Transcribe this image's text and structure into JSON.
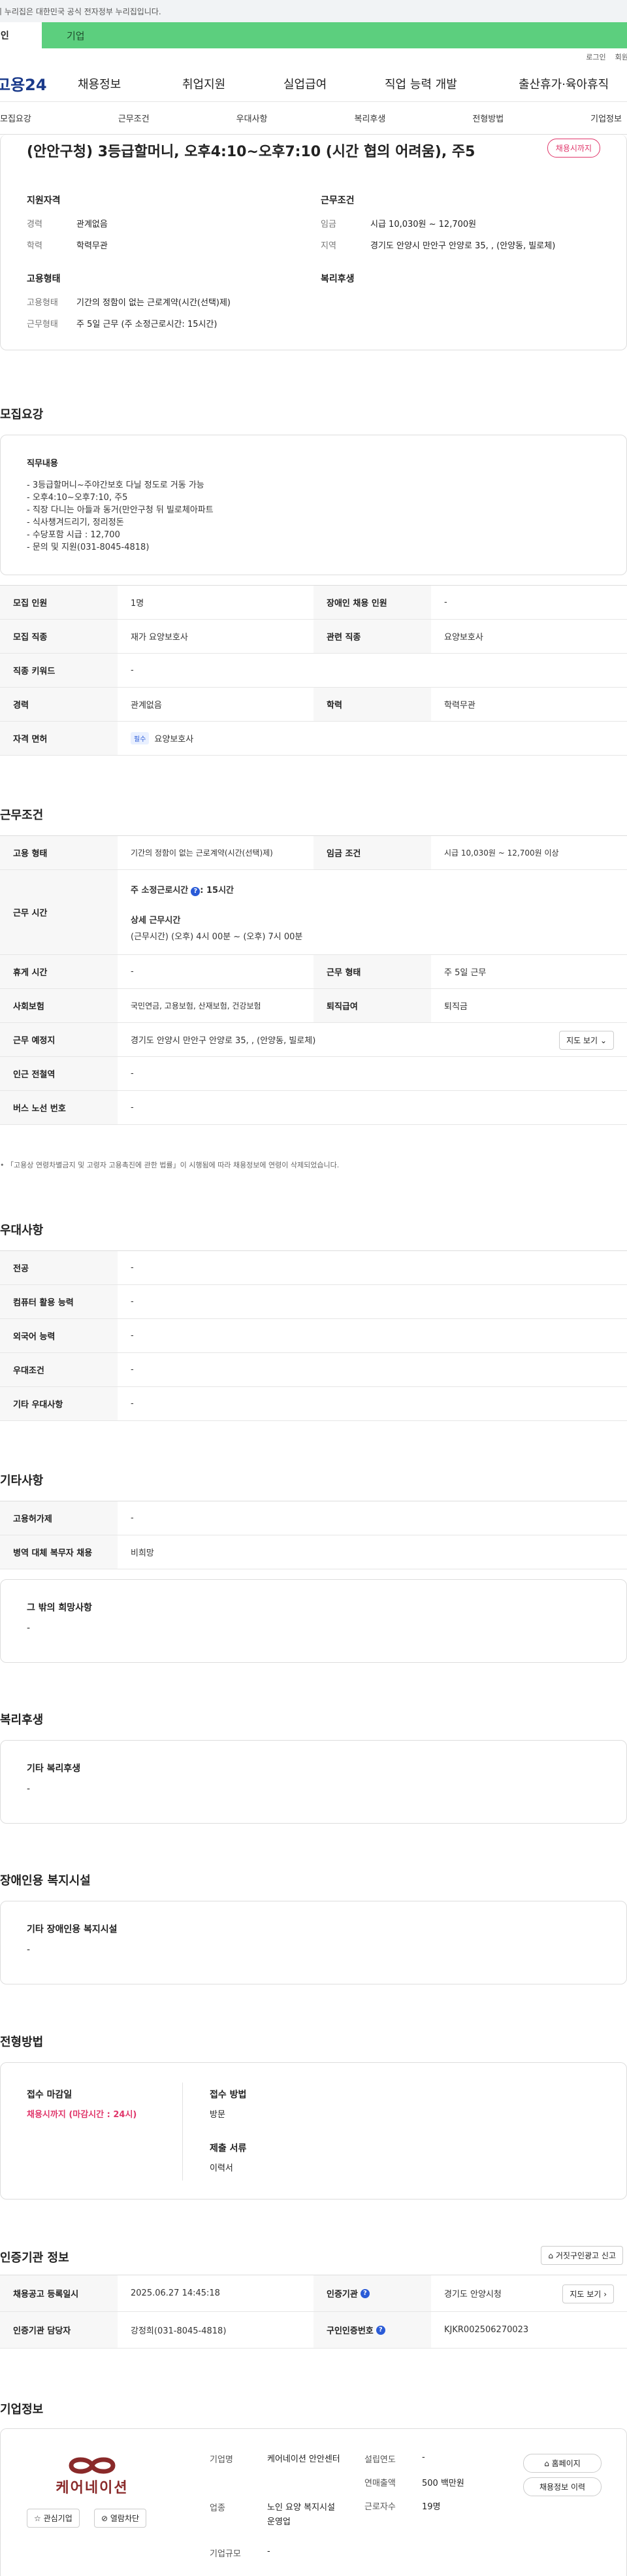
{
  "gov_notice": "이 누리집은 대한민국 공식 전자정부 누리집입니다.",
  "top_tabs": {
    "personal": "개인",
    "company": "기업"
  },
  "util": {
    "login": "로그인",
    "signup": "회원가"
  },
  "gnb": {
    "logo": "고용24",
    "items": [
      "채용정보",
      "취업지원",
      "실업급여",
      "직업 능력 개발",
      "출산휴가·육아휴직"
    ]
  },
  "subnav": [
    "모집요강",
    "근무조건",
    "우대사항",
    "복리후생",
    "전형방법",
    "기업정보"
  ],
  "summary": {
    "title": "(안안구청) 3등급할머니, 오후4:10~오후7:10 (시간 협의 어려움), 주5",
    "badge": "채용시까지",
    "qual": {
      "heading": "지원자격",
      "rows": [
        [
          "경력",
          "관계없음"
        ],
        [
          "학력",
          "학력무관"
        ]
      ]
    },
    "cond": {
      "heading": "근무조건",
      "rows": [
        [
          "임금",
          "시급 10,030원 ~ 12,700원"
        ],
        [
          "지역",
          "경기도 안양시 만안구 안양로 35, , (안양동, 빌로체)"
        ]
      ]
    },
    "emp": {
      "heading": "고용형태",
      "rows": [
        [
          "고용형태",
          "기간의 정함이 없는 근로계약(시간(선택)제)"
        ],
        [
          "근무형태",
          "주 5일 근무 (주 소정근로시간: 15시간)"
        ]
      ]
    },
    "welfare": {
      "heading": "복리후생"
    }
  },
  "recruit": {
    "title": "모집요강",
    "duty_heading": "직무내용",
    "duty_lines": [
      "- 3등급할머니~주야간보호 다닐 정도로 거동 가능",
      "- 오후4:10~오후7:10, 주5",
      "- 직장 다니는 아들과 동거(만안구청 뒤 빌로체아파트",
      "- 식사챙겨드리기, 정리정돈",
      "- 수당포함 시급 : 12,700",
      "- 문의 및 지원(031-8045-4818)"
    ],
    "rows": [
      {
        "k1": "모집 인원",
        "v1": "1명",
        "k2": "장애인 채용 인원",
        "v2": "-"
      },
      {
        "k1": "모집 직종",
        "v1": "재가 요양보호사",
        "k2": "관련 직종",
        "v2": "요양보호사"
      },
      {
        "k1": "직종 키워드",
        "v1": "-"
      },
      {
        "k1": "경력",
        "v1": "관계없음",
        "k2": "학력",
        "v2": "학력무관"
      },
      {
        "k1": "자격 면허",
        "tag": "필수",
        "v1": "요양보호사"
      }
    ]
  },
  "work": {
    "title": "근무조건",
    "emp_k": "고용 형태",
    "emp_v": "기간의 정함이 없는 근로계약(시간(선택)제)",
    "wage_k": "임금 조건",
    "wage_v": "시급 10,030원 ~ 12,700원 이상",
    "time_k": "근무 시간",
    "time_weekly": "주 소정근로시간",
    "time_weekly_v": ": 15시간",
    "time_detail_h": "상세 근무시간",
    "time_detail": "(근무시간) (오후) 4시 00분 ~ (오후) 7시 00분",
    "rest_k": "휴게 시간",
    "rest_v": "-",
    "form_k": "근무 형태",
    "form_v": "주 5일 근무",
    "ins_k": "사회보험",
    "ins_v": "국민연금, 고용보험, 산재보험, 건강보험",
    "ret_k": "퇴직급여",
    "ret_v": "퇴직금",
    "place_k": "근무 예정지",
    "place_v": "경기도 안양시 만안구 안양로 35, , (안양동, 빌로체)",
    "map_btn": "지도 보기",
    "sub_k": "인근 전철역",
    "sub_v": "-",
    "bus_k": "버스 노선 번호",
    "bus_v": "-",
    "note": "「고용상 연령차별금지 및 고령자 고용촉진에 관한 법률」이 시행됨에 따라 채용정보에 연령이 삭제되었습니다."
  },
  "pref": {
    "title": "우대사항",
    "rows": [
      [
        "전공",
        "-"
      ],
      [
        "컴퓨터 활용 능력",
        "-"
      ],
      [
        "외국어 능력",
        "-"
      ],
      [
        "우대조건",
        "-"
      ],
      [
        "기타 우대사항",
        "-"
      ]
    ]
  },
  "etc": {
    "title": "기타사항",
    "rows": [
      [
        "고용허가제",
        "-"
      ],
      [
        "병역 대체 복무자 채용",
        "비희망"
      ]
    ],
    "other_h": "그 밖의 희망사항",
    "other_v": "-"
  },
  "welfare": {
    "title": "복리후생",
    "h": "기타 복리후생",
    "v": "-"
  },
  "disab": {
    "title": "장애인용 복지시설",
    "h": "기타 장애인용 복지시설",
    "v": "-"
  },
  "process": {
    "title": "전형방법",
    "deadline_h": "접수 마감일",
    "deadline_v": "채용시까지 (마감시간 : 24시)",
    "method_h": "접수 방법",
    "method_v": "방문",
    "docs_h": "제출 서류",
    "docs_v": "이력서"
  },
  "cert": {
    "title": "인증기관 정보",
    "report_btn": "거짓구인광고 신고",
    "reg_k": "채용공고 등록일시",
    "reg_v": "2025.06.27 14:45:18",
    "org_k": "인증기관",
    "org_v": "경기도 안양시청",
    "map_btn": "지도 보기",
    "mgr_k": "인증기관 담당자",
    "mgr_v": "강정희(031-8045-4818)",
    "no_k": "구인인증번호",
    "no_v": "KJKR002506270023"
  },
  "company": {
    "title": "기업정보",
    "logo_text": "케어네이션",
    "fav_btn": "관심기업",
    "block_btn": "열람차단",
    "name_k": "기업명",
    "name_v": "케어네이션 안안센터",
    "ind_k": "업종",
    "ind_v": "노인 요양 복지시설 운영업",
    "size_k": "기업규모",
    "size_v": "-",
    "est_k": "설립연도",
    "est_v": "-",
    "sales_k": "연매출액",
    "sales_v": "500 백만원",
    "emp_k": "근로자수",
    "emp_v": "19명",
    "home_btn": "홈페이지",
    "hist_btn": "채용정보 이력"
  }
}
